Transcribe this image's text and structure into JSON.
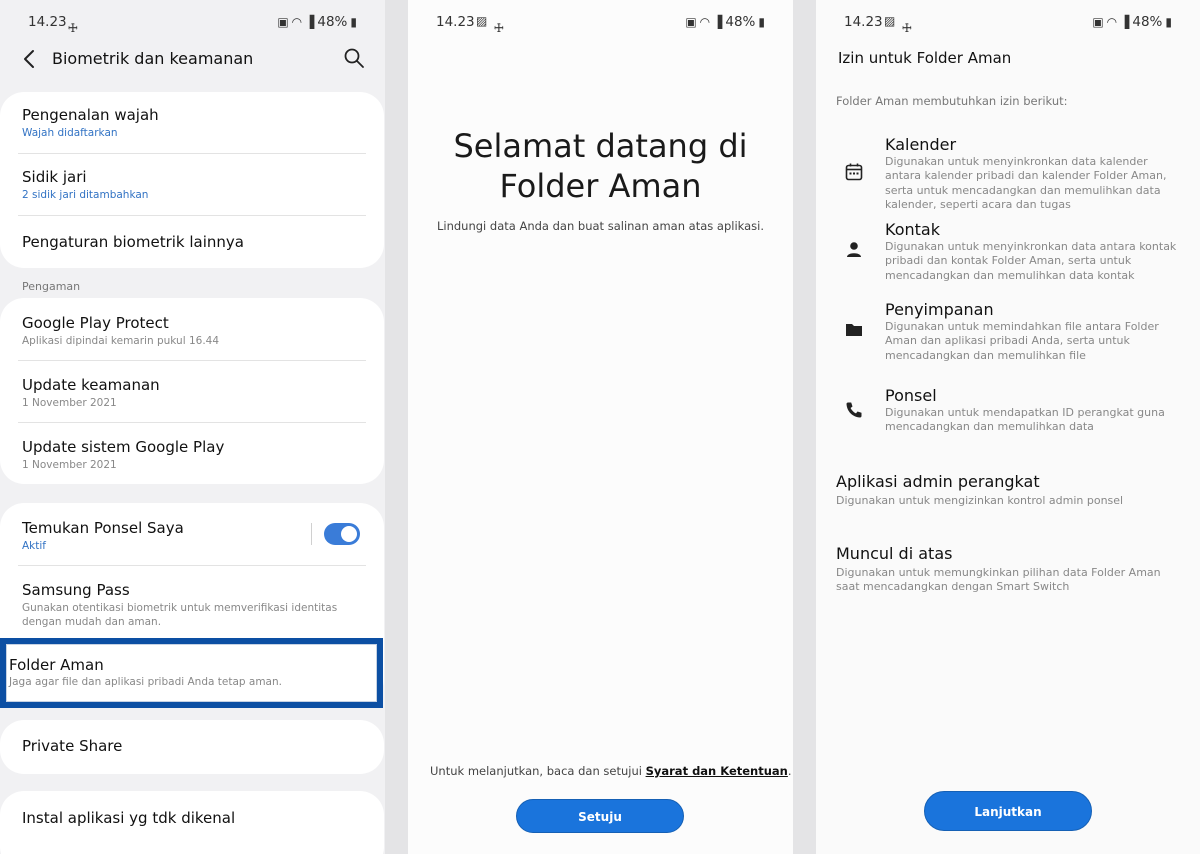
{
  "status": {
    "time": "14.23",
    "battery": "48%"
  },
  "screen1": {
    "title": "Biometrik dan keamanan",
    "biometric_items": [
      {
        "title": "Pengenalan wajah",
        "sub": "Wajah didaftarkan"
      },
      {
        "title": "Sidik jari",
        "sub": "2 sidik jari ditambahkan"
      },
      {
        "title": "Pengaturan biometrik lainnya",
        "sub": ""
      }
    ],
    "section_label": "Pengaman",
    "security_items": [
      {
        "title": "Google Play Protect",
        "sub": "Aplikasi dipindai kemarin pukul 16.44"
      },
      {
        "title": "Update keamanan",
        "sub": "1 November 2021"
      },
      {
        "title": "Update sistem Google Play",
        "sub": "1 November 2021"
      }
    ],
    "find_phone": {
      "title": "Temukan Ponsel Saya",
      "sub": "Aktif",
      "toggle_on": true
    },
    "samsung_pass": {
      "title": "Samsung Pass",
      "sub": "Gunakan otentikasi biometrik untuk memverifikasi identitas dengan mudah dan aman."
    },
    "secure_folder": {
      "title": "Folder Aman",
      "sub": "Jaga agar file dan aplikasi pribadi Anda tetap aman."
    },
    "private_share": {
      "title": "Private Share"
    },
    "unknown_apps": {
      "title": "Instal aplikasi yg tdk dikenal"
    }
  },
  "screen2": {
    "heading_line1": "Selamat datang di",
    "heading_line2": "Folder Aman",
    "subtitle": "Lindungi data Anda dan buat salinan aman atas aplikasi.",
    "terms_prefix": "Untuk melanjutkan, baca dan setujui ",
    "terms_link": "Syarat dan Ketentuan",
    "terms_suffix": ".",
    "agree_button": "Setuju"
  },
  "screen3": {
    "title": "Izin untuk Folder Aman",
    "intro": "Folder Aman membutuhkan izin berikut:",
    "permissions": [
      {
        "icon": "calendar-icon",
        "title": "Kalender",
        "desc": "Digunakan untuk menyinkronkan data kalender antara kalender pribadi dan kalender Folder Aman, serta untuk mencadangkan dan memulihkan data kalender, seperti acara dan tugas"
      },
      {
        "icon": "person-icon",
        "title": "Kontak",
        "desc": "Digunakan untuk menyinkronkan data antara kontak pribadi dan kontak Folder Aman, serta untuk mencadangkan dan memulihkan data kontak"
      },
      {
        "icon": "folder-icon",
        "title": "Penyimpanan",
        "desc": "Digunakan untuk memindahkan file antara Folder Aman dan aplikasi pribadi Anda, serta untuk mencadangkan dan memulihkan file"
      },
      {
        "icon": "phone-icon",
        "title": "Ponsel",
        "desc": "Digunakan untuk mendapatkan ID perangkat guna mencadangkan dan memulihkan data"
      }
    ],
    "device_admin": {
      "title": "Aplikasi admin perangkat",
      "desc": "Digunakan untuk mengizinkan kontrol admin ponsel"
    },
    "overlay": {
      "title": "Muncul di atas",
      "desc": "Digunakan untuk memungkinkan pilihan data Folder Aman saat mencadangkan dengan Smart Switch"
    },
    "continue_button": "Lanjutkan"
  },
  "colors": {
    "accent": "#1a74dc",
    "highlight_border": "#0c4fa3",
    "link_blue": "#3273c4"
  }
}
